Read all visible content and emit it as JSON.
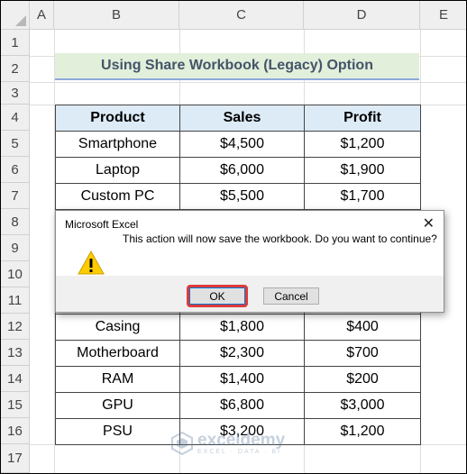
{
  "columns": [
    "A",
    "B",
    "C",
    "D",
    "E"
  ],
  "rows": [
    "1",
    "2",
    "3",
    "4",
    "5",
    "6",
    "7",
    "8",
    "9",
    "10",
    "11",
    "12",
    "13",
    "14",
    "15",
    "16",
    "17"
  ],
  "title": "Using Share Workbook (Legacy) Option",
  "table": {
    "headers": {
      "product": "Product",
      "sales": "Sales",
      "profit": "Profit"
    },
    "rows": [
      {
        "product": "Smartphone",
        "sales": "$4,500",
        "profit": "$1,200"
      },
      {
        "product": "Laptop",
        "sales": "$6,000",
        "profit": "$1,900"
      },
      {
        "product": "Custom PC",
        "sales": "$5,500",
        "profit": "$1,700"
      },
      {
        "product": "",
        "sales": "",
        "profit": ""
      },
      {
        "product": "",
        "sales": "",
        "profit": ""
      },
      {
        "product": "",
        "sales": "",
        "profit": ""
      },
      {
        "product": "",
        "sales": "",
        "profit": ""
      },
      {
        "product": "Casing",
        "sales": "$1,800",
        "profit": "$400"
      },
      {
        "product": "Motherboard",
        "sales": "$2,300",
        "profit": "$700"
      },
      {
        "product": "RAM",
        "sales": "$1,400",
        "profit": "$200"
      },
      {
        "product": "GPU",
        "sales": "$6,800",
        "profit": "$3,000"
      },
      {
        "product": "PSU",
        "sales": "$3,200",
        "profit": "$1,200"
      }
    ]
  },
  "dialog": {
    "title": "Microsoft Excel",
    "close": "✕",
    "message": "This action will now save the workbook. Do you want to continue?",
    "ok_label": "OK",
    "cancel_label": "Cancel",
    "icon": "warning-icon"
  },
  "watermark": {
    "name": "exceldemy",
    "tagline": "EXCEL · DATA · BI"
  },
  "colors": {
    "title_bg": "#e2efda",
    "header_bg": "#ddebf7",
    "highlight": "#e03a3a"
  }
}
